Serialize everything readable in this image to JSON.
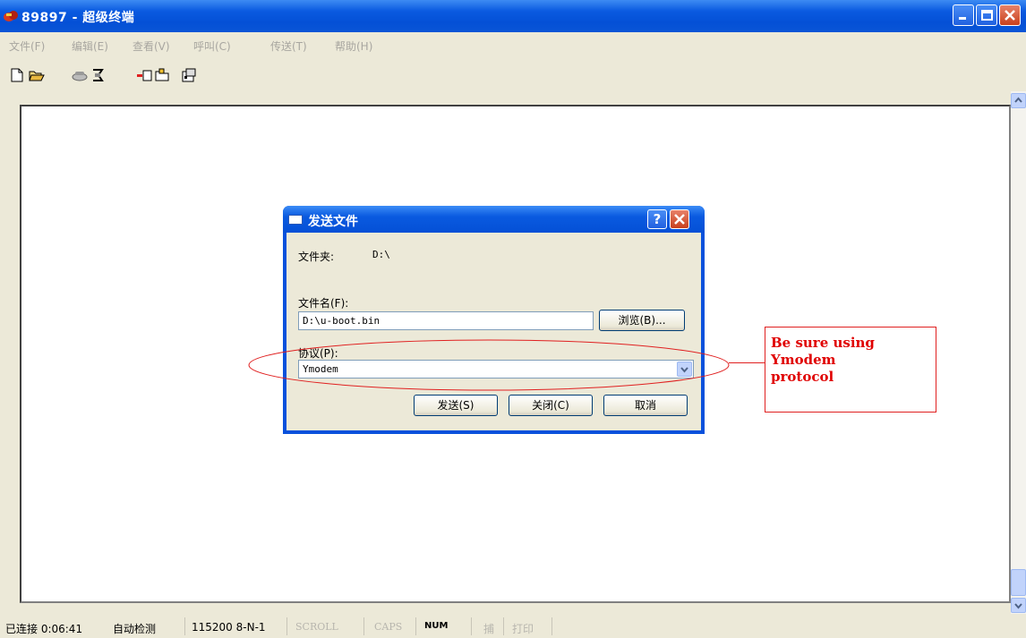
{
  "window": {
    "title": "89897 - 超级终端"
  },
  "menu": [
    "文件(F)",
    "编辑(E)",
    "查看(V)",
    "呼叫(C)",
    "传送(T)",
    "帮助(H)"
  ],
  "toolbar": {
    "icons": [
      "new-file-icon",
      "open-folder-icon",
      "phone-icon",
      "disconnect-icon",
      "send-icon",
      "receive-icon",
      "properties-icon"
    ]
  },
  "dialog": {
    "title": "发送文件",
    "help_label": "?",
    "folder_label": "文件夹:",
    "folder_value": "D:\\",
    "filename_label": "文件名(F):",
    "filename_value": "D:\\u-boot.bin",
    "browse_label": "浏览(B)...",
    "protocol_label": "协议(P):",
    "protocol_value": "Ymodem",
    "send_label": "发送(S)",
    "close_label": "关闭(C)",
    "cancel_label": "取消"
  },
  "annotation": {
    "text": "Be sure using\nYmodem\nprotocol",
    "color": "#e00000"
  },
  "status": {
    "connected": "已连接 0:06:41",
    "detect": "自动检测",
    "baud": "115200 8-N-1",
    "scroll": "SCROLL",
    "caps": "CAPS",
    "num": "NUM",
    "capture": "捕",
    "print": "打印"
  },
  "colors": {
    "xp_blue": "#0a5ae0",
    "xp_face": "#ece9d8",
    "annotation_red": "#e02020"
  }
}
